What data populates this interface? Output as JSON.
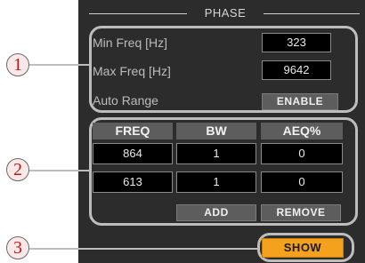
{
  "section": {
    "title": "PHASE"
  },
  "callouts": [
    "1",
    "2",
    "3"
  ],
  "freq": {
    "min_label": "Min Freq [Hz]",
    "min_value": "323",
    "max_label": "Max Freq [Hz]",
    "max_value": "9642",
    "auto_range_label": "Auto Range",
    "enable_label": "ENABLE"
  },
  "table": {
    "headers": [
      "FREQ",
      "BW",
      "AEQ%"
    ],
    "rows": [
      [
        "864",
        "1",
        "0"
      ],
      [
        "613",
        "1",
        "0"
      ]
    ],
    "add_label": "ADD",
    "remove_label": "REMOVE"
  },
  "show_label": "SHOW",
  "colors": {
    "panel_bg": "#2c2c2c",
    "callout_outline": "#bdbdbd",
    "callout_number": "#b31b1b",
    "show_button": "#f4a21d"
  }
}
